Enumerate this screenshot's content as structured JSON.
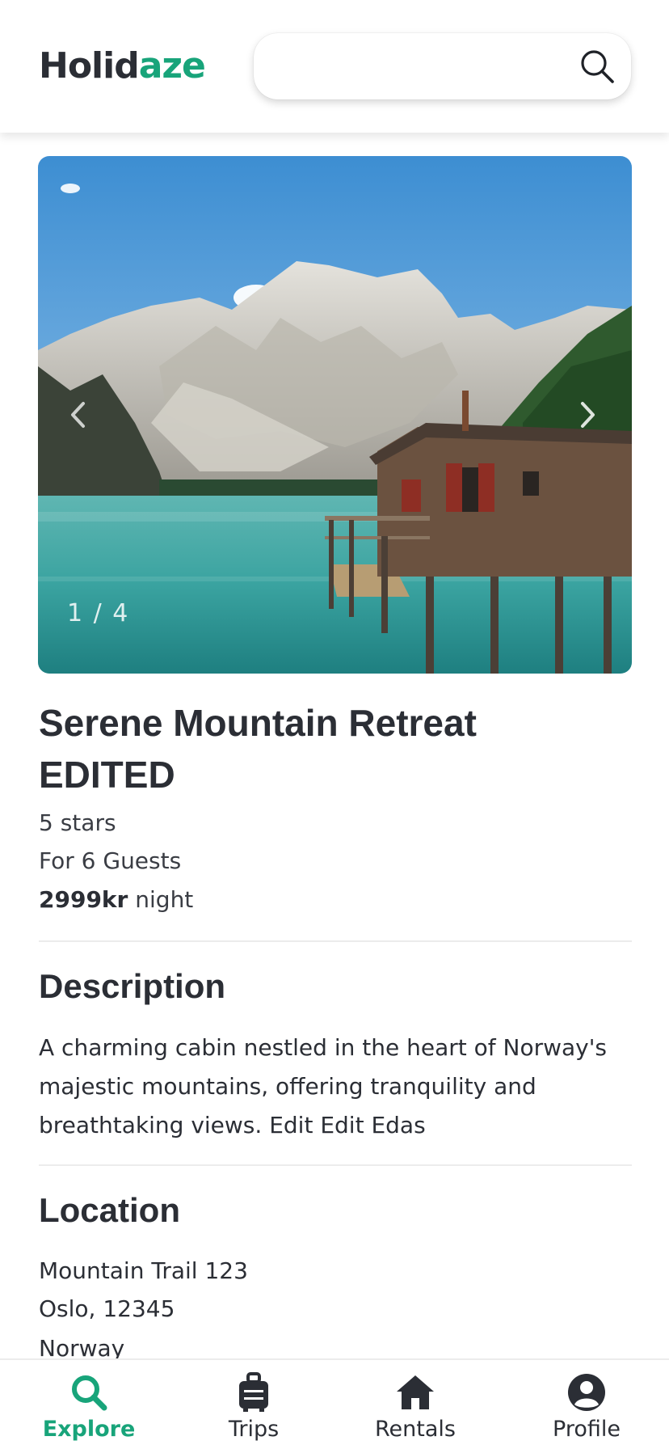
{
  "brand": {
    "part1": "Holid",
    "part2": "aze"
  },
  "search": {
    "placeholder": "",
    "value": ""
  },
  "gallery": {
    "counter": "1 / 4",
    "current": 1,
    "total": 4
  },
  "listing": {
    "title": "Serene Mountain Retreat EDITED",
    "stars": "5 stars",
    "guests": "For 6 Guests",
    "price": "2999kr",
    "price_unit": "night"
  },
  "description": {
    "heading": "Description",
    "text": "A charming cabin nestled in the heart of Norway's majestic mountains, offering tranquility and breathtaking views. Edit Edit Edas"
  },
  "location": {
    "heading": "Location",
    "street": "Mountain Trail 123",
    "city_zip": "Oslo, 12345",
    "country": "Norway"
  },
  "bottom_nav": [
    {
      "label": "Explore",
      "icon": "search-icon",
      "active": true
    },
    {
      "label": "Trips",
      "icon": "suitcase-icon",
      "active": false
    },
    {
      "label": "Rentals",
      "icon": "home-icon",
      "active": false
    },
    {
      "label": "Profile",
      "icon": "user-circle-icon",
      "active": false
    }
  ],
  "colors": {
    "brand_accent": "#18a47a",
    "text_dark": "#2b2e35",
    "divider": "#ececec"
  }
}
